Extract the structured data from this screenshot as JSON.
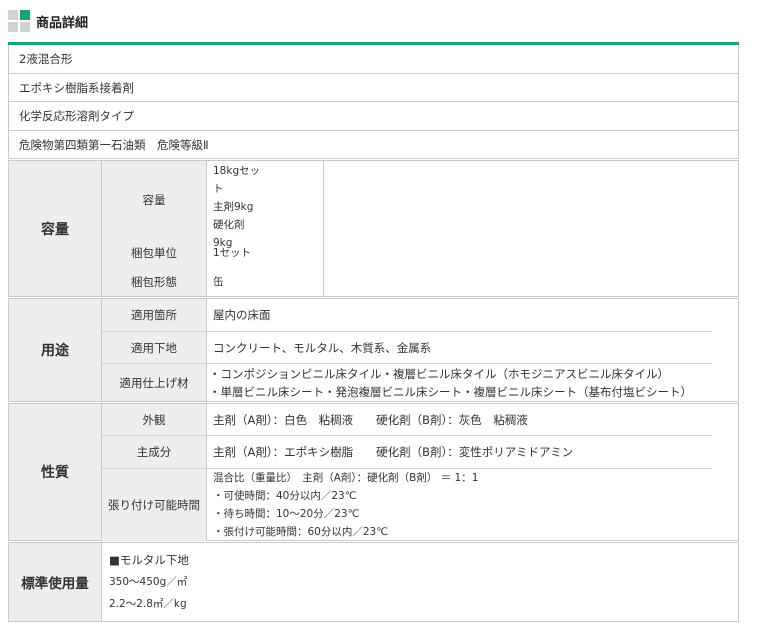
{
  "header": {
    "title": "商品詳細",
    "accent_color": "#1aa37a"
  },
  "features": [
    "2液混合形",
    "エポキシ樹脂系接着剤",
    "化学反応形溶剤タイプ",
    "危険物第四類第一石油類　危険等級Ⅱ"
  ],
  "capacity": {
    "category": "容量",
    "volume_label": "容量",
    "volume_lines": [
      "18kgセット",
      "主剤9kg",
      "硬化剤",
      "9kg"
    ],
    "unit_label": "梱包単位",
    "unit_value": "1セット",
    "form_label": "梱包形態",
    "form_value": "缶"
  },
  "usage": {
    "category": "用途",
    "place_label": "適用箇所",
    "place_value": "屋内の床面",
    "substrate_label": "適用下地",
    "substrate_value": "コンクリート、モルタル、木質系、金属系",
    "finish_label": "適用仕上げ材",
    "finish_lines": [
      "・コンポジションビニル床タイル・複層ビニル床タイル（ホモジニアスビニル床タイル）",
      "・単層ビニル床シート・発泡複層ビニル床シート・複層ビニル床シート（基布付塩ビシート）"
    ]
  },
  "properties": {
    "category": "性質",
    "appearance_label": "外観",
    "appearance_value": "主剤（A剤）：白色　粘稠液　　硬化剤（B剤）：灰色　粘稠液",
    "component_label": "主成分",
    "component_value": "主剤（A剤）：エポキシ樹脂　　硬化剤（B剤）：変性ポリアミドアミン",
    "time_label": "張り付け可能時間",
    "time_lines": [
      "混合比（重量比）　主剤（A剤）：硬化剤（B剤） ＝ 1：1",
      "・可使時間：40分以内／23℃",
      "・待ち時間：10～20分／23℃",
      "・張付け可能時間：60分以内／23℃"
    ]
  },
  "standard": {
    "category": "標準使用量",
    "lines": [
      "■モルタル下地",
      "350～450g／㎡",
      "2.2～2.8㎡／kg"
    ]
  }
}
